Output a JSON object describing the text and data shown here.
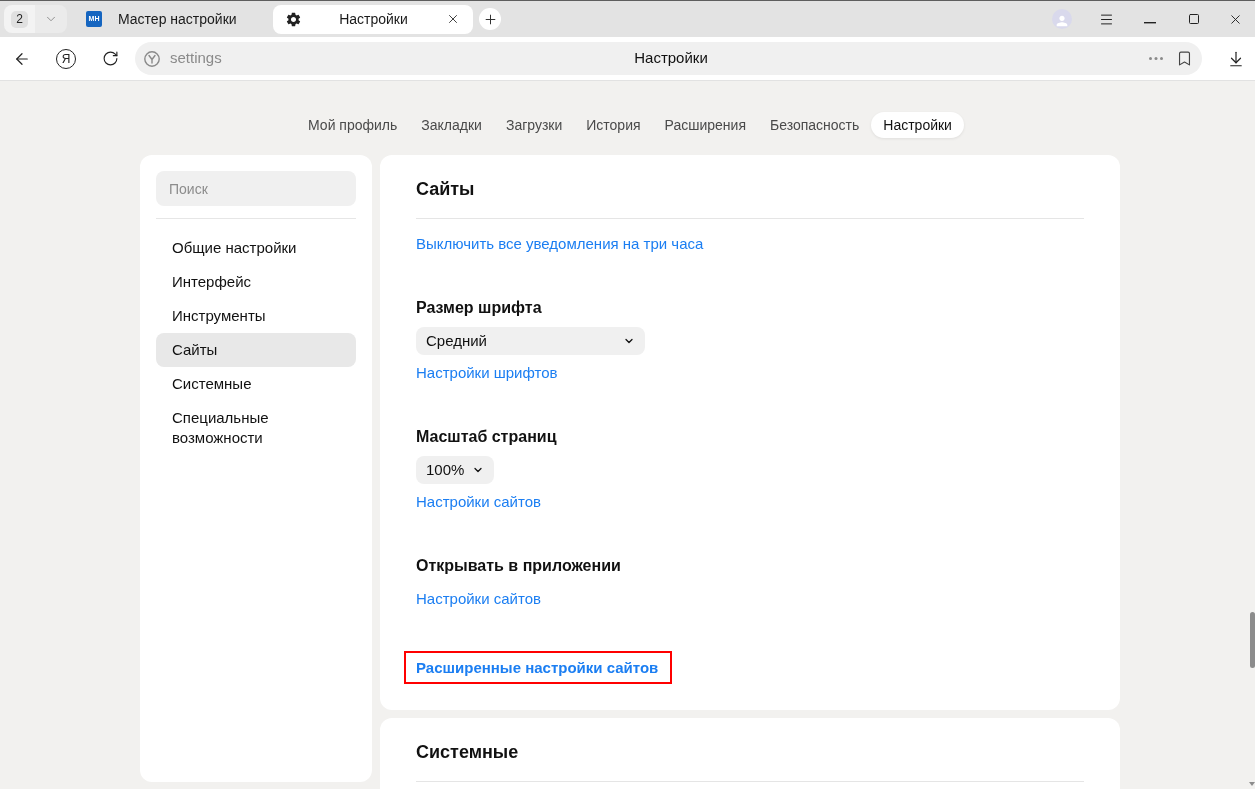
{
  "browser": {
    "tab_count": "2",
    "tabs": [
      {
        "kind": "site",
        "favicon_text": "МН",
        "title": "Мастер настройки",
        "selected": false
      },
      {
        "kind": "settings",
        "title": "Настройки",
        "selected": true
      }
    ],
    "address_bar": {
      "home_label": "Я",
      "url": "settings",
      "page_title": "Настройки"
    }
  },
  "page_nav": [
    {
      "label": "Мой профиль",
      "selected": false
    },
    {
      "label": "Закладки",
      "selected": false
    },
    {
      "label": "Загрузки",
      "selected": false
    },
    {
      "label": "История",
      "selected": false
    },
    {
      "label": "Расширения",
      "selected": false
    },
    {
      "label": "Безопасность",
      "selected": false
    },
    {
      "label": "Настройки",
      "selected": true
    }
  ],
  "sidebar": {
    "search": {
      "placeholder": "Поиск"
    },
    "items": [
      {
        "label": "Общие настройки",
        "selected": false
      },
      {
        "label": "Интерфейс",
        "selected": false
      },
      {
        "label": "Инструменты",
        "selected": false
      },
      {
        "label": "Сайты",
        "selected": true
      },
      {
        "label": "Системные",
        "selected": false
      },
      {
        "label": "Специальные возможности",
        "selected": false
      }
    ]
  },
  "sections": [
    {
      "title": "Сайты",
      "items": [
        {
          "kind": "link",
          "text": "Выключить все уведомления на три часа",
          "highlighted": false
        },
        {
          "kind": "heading",
          "text": "Размер шрифта"
        },
        {
          "kind": "select",
          "value": "Средний",
          "wide": true
        },
        {
          "kind": "link",
          "text": "Настройки шрифтов",
          "highlighted": false
        },
        {
          "kind": "heading",
          "text": "Масштаб страниц"
        },
        {
          "kind": "select",
          "value": "100%",
          "wide": false
        },
        {
          "kind": "link",
          "text": "Настройки сайтов",
          "highlighted": false
        },
        {
          "kind": "heading",
          "text": "Открывать в приложении"
        },
        {
          "kind": "link",
          "text": "Настройки сайтов",
          "highlighted": false
        },
        {
          "kind": "strong_link",
          "text": "Расширенные настройки сайтов",
          "highlighted": true
        }
      ]
    },
    {
      "title": "Системные"
    }
  ]
}
